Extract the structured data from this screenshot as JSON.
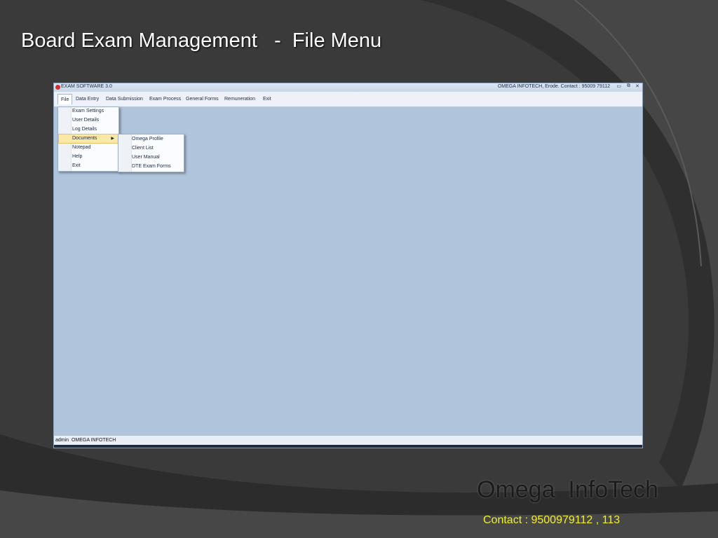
{
  "slide": {
    "title": "Board Exam Management   -  File Menu",
    "brand": "Omega  InfoTech",
    "contact": "Contact : 9500979112 , 113"
  },
  "window": {
    "title": "EXAM SOFTWARE 3.0",
    "company_contact": "OMEGA INFOTECH, Erode. Contact : 95009 79112",
    "controls": {
      "minimize": "▭",
      "restore": "⧉",
      "close": "✕"
    }
  },
  "menubar": {
    "items": [
      "File",
      "Data Entry",
      "Data Submission",
      "Exam Process",
      "General Forms",
      "Remuneration",
      "Exit"
    ],
    "active": "File"
  },
  "file_menu": {
    "items": [
      "Exam Settings",
      "User Details",
      "Log Details",
      "Documents",
      "Notepad",
      "Help",
      "Exit"
    ],
    "highlighted": "Documents",
    "submenu_arrow": "▶"
  },
  "documents_submenu": {
    "items": [
      "Omega Profile",
      "Client List",
      "User Manual",
      "DTE Exam Forms"
    ]
  },
  "statusbar": {
    "text": "admin  OMEGA INFOTECH"
  },
  "colors": {
    "slide_background": "#3c3c3c",
    "workspace": "#b0c4dc",
    "highlight": "#fbe7a6",
    "contact_text": "#f2ef2c"
  }
}
